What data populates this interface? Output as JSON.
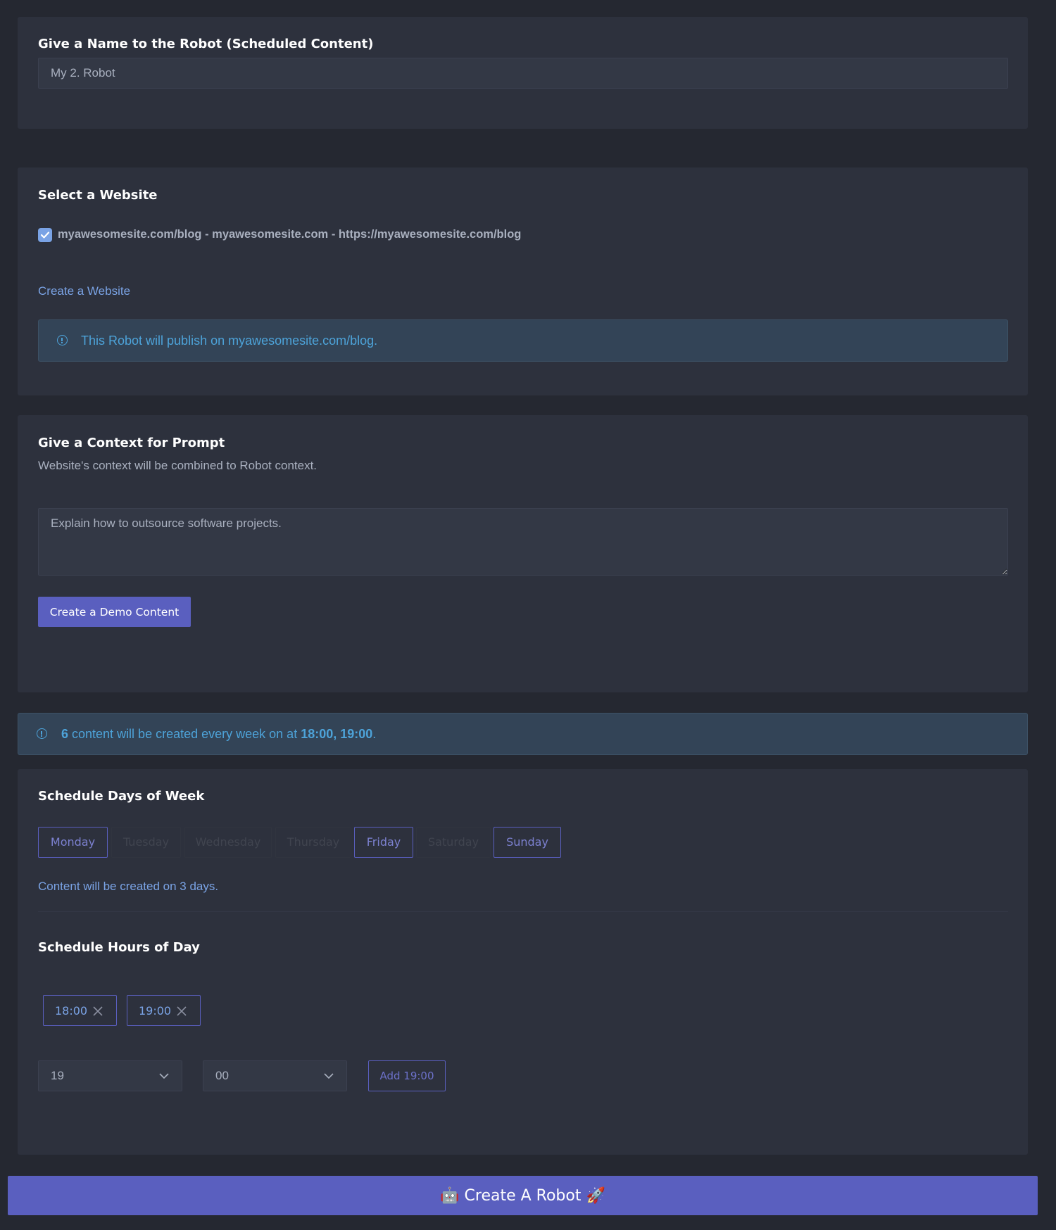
{
  "name_section": {
    "title": "Give a Name to the Robot (Scheduled Content)",
    "name_value": "My 2. Robot"
  },
  "website_section": {
    "title": "Select a Website",
    "website_option": "myawesomesite.com/blog - myawesomesite.com - https://myawesomesite.com/blog",
    "website_checked": true,
    "create_link": "Create a Website",
    "alert_text": "This Robot will publish on myawesomesite.com/blog."
  },
  "context_section": {
    "title": "Give a Context for Prompt",
    "subtitle": "Website's context will be combined to Robot context.",
    "context_value": "Explain how to outsource software projects.",
    "demo_button": "Create a Demo Content"
  },
  "summary_alert": {
    "count": "6",
    "middle": " content will be created every week on at ",
    "times": "18:00, 19:00",
    "end": "."
  },
  "schedule_section": {
    "days_title": "Schedule Days of Week",
    "days": [
      {
        "label": "Monday",
        "active": true
      },
      {
        "label": "Tuesday",
        "active": false
      },
      {
        "label": "Wednesday",
        "active": false
      },
      {
        "label": "Thursday",
        "active": false
      },
      {
        "label": "Friday",
        "active": true
      },
      {
        "label": "Saturday",
        "active": false
      },
      {
        "label": "Sunday",
        "active": true
      }
    ],
    "days_summary": "Content will be created on 3 days.",
    "hours_title": "Schedule Hours of Day",
    "hours": [
      "18:00",
      "19:00"
    ],
    "hour_select": "19",
    "minute_select": "00",
    "add_button": "Add 19:00"
  },
  "footer": {
    "create_button": "🤖 Create A Robot 🚀"
  },
  "colors": {
    "background": "#252831",
    "card": "#2d313d",
    "accent": "#5a5fbf",
    "link": "#7aa3e5",
    "info": "#4da3d9"
  }
}
